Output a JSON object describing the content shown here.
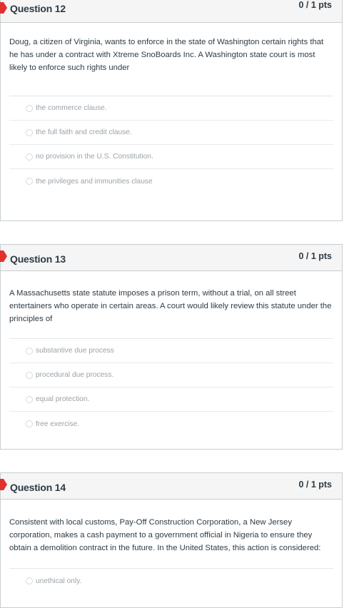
{
  "questions": [
    {
      "title": "Question 12",
      "points": "0 / 1 pts",
      "text": "Doug, a citizen of Virginia, wants to enforce in the state of Washington certain rights that he has under a contract with Xtreme SnoBoards Inc. A Washington state court is most likely to enforce such rights under",
      "answers": [
        "the commerce clause.",
        "the full faith and credit clause.",
        "no provision in the U.S. Constitution.",
        "the privileges and immunities clause"
      ]
    },
    {
      "title": "Question 13",
      "points": "0 / 1 pts",
      "text": "A Massachusetts state statute imposes a prison term, without a trial, on all street entertainers who operate in certain areas. A court would likely review this statute under the principles of",
      "answers": [
        "substantive due process",
        "procedural due process.",
        "equal protection.",
        "free exercise."
      ]
    },
    {
      "title": "Question 14",
      "points": "0 / 1 pts",
      "text": "Consistent with local customs, Pay-Off Construction Corporation, a New Jersey corporation, makes a cash payment to a government official in Nigeria to ensure they obtain a demolition contract in the future. In the United States, this action is considered:",
      "answers": [
        "unethical only."
      ]
    }
  ],
  "colors": {
    "flag": "#e0312f",
    "header_bg": "#f5f5f5",
    "border": "#c7cdd1",
    "text": "#2d3b45",
    "answer_text": "#9aa3a9"
  }
}
